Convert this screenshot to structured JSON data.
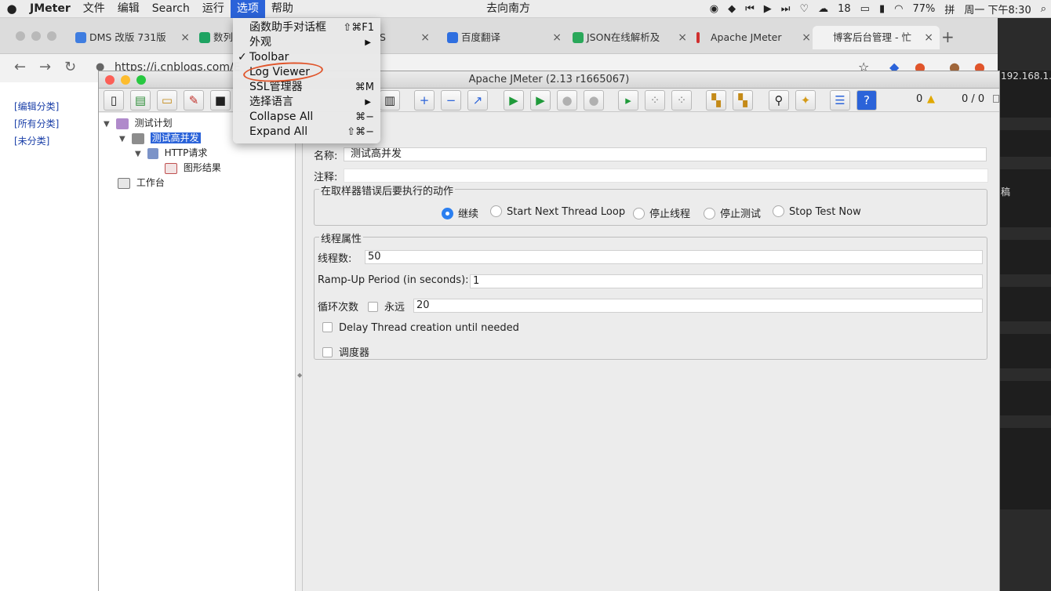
{
  "menubar": {
    "apple_icon": "apple-icon",
    "app_name": "JMeter",
    "items": [
      "文件",
      "编辑",
      "Search",
      "运行",
      "选项",
      "帮助"
    ],
    "active_item": "选项",
    "song": "去向南方",
    "wechat_count": "18",
    "battery": "77%",
    "datetime": "周一 下午8:30"
  },
  "browser": {
    "tabs": [
      {
        "label": "DMS 改版 731版",
        "color": "#3f7de0"
      },
      {
        "label": "数列",
        "color": "#1ea362"
      },
      {
        "label": "S",
        "color": "#888888"
      },
      {
        "label": "百度翻译",
        "color": "#2f6fe0"
      },
      {
        "label": "JSON在线解析及",
        "color": "#2aa85a"
      },
      {
        "label": "Apache JMeter",
        "color": "#d0302f"
      },
      {
        "label": "博客后台管理 - 忙",
        "color": "#cccccc"
      }
    ],
    "url": "https://i.cnblogs.com/E",
    "blog_links": [
      "[编辑分类]",
      "[所有分类]",
      "[未分类]"
    ],
    "side_ip": "192.168.1.",
    "side_char": "稿"
  },
  "jmeter": {
    "title": "Apache JMeter (2.13 r1665067)",
    "warn_count": "0",
    "thread_count": "0 / 0",
    "tree": {
      "test_plan": "测试计划",
      "thread_group": "测试高并发",
      "http_request": "HTTP请求",
      "graph_results": "图形结果",
      "workbench": "工作台"
    },
    "form": {
      "name_label": "名称:",
      "name_value": "测试高并发",
      "comment_label": "注释:",
      "comment_value": "",
      "error_group_title": "在取样器错误后要执行的动作",
      "error_options": [
        "继续",
        "Start Next Thread Loop",
        "停止线程",
        "停止测试",
        "Stop Test Now"
      ],
      "error_selected": "继续",
      "thread_props_title": "线程属性",
      "threads_label": "线程数:",
      "threads_value": "50",
      "rampup_label": "Ramp-Up Period (in seconds):",
      "rampup_value": "1",
      "loop_label": "循环次数",
      "forever_label": "永远",
      "loop_value": "20",
      "delay_label": "Delay Thread creation until needed",
      "scheduler_label": "调度器"
    }
  },
  "options_menu": {
    "items": [
      {
        "label": "函数助手对话框",
        "shortcut": "⇧⌘F1"
      },
      {
        "label": "外观",
        "submenu": "▶"
      },
      {
        "label": "Toolbar",
        "check": "✓"
      },
      {
        "label": "Log Viewer"
      },
      {
        "label": "SSL管理器",
        "shortcut": "⌘M"
      },
      {
        "label": "选择语言",
        "submenu": "▶"
      },
      {
        "label": "Collapse All",
        "shortcut": "⌘−"
      },
      {
        "label": "Expand All",
        "shortcut": "⇧⌘−"
      }
    ]
  }
}
